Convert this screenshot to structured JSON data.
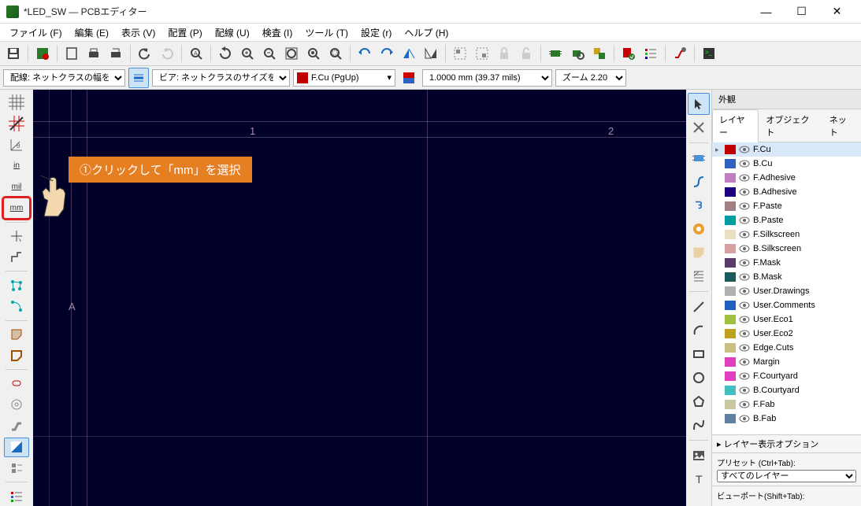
{
  "window": {
    "title": "*LED_SW — PCBエディター"
  },
  "menu": {
    "file": "ファイル (F)",
    "edit": "編集 (E)",
    "view": "表示 (V)",
    "place": "配置 (P)",
    "route": "配線 (U)",
    "inspect": "検査 (I)",
    "tools": "ツール (T)",
    "preferences": "設定 (r)",
    "help": "ヘルプ (H)"
  },
  "options_bar": {
    "track_width_label": "配線: ネットクラスの幅を使用",
    "via_label": "ビア: ネットクラスのサイズを使用",
    "active_layer": "F.Cu (PgUp)",
    "grid_value": "1.0000 mm (39.37 mils)",
    "zoom_value": "ズーム 2.20"
  },
  "left_toolbar": {
    "in_label": "in",
    "mil_label": "mil",
    "mm_label": "mm"
  },
  "canvas": {
    "col1": "1",
    "col2": "2",
    "rowA": "A"
  },
  "callout": {
    "text": "①クリックして「mm」を選択"
  },
  "appearance": {
    "title": "外観",
    "tabs": {
      "layers": "レイヤー",
      "objects": "オブジェクト",
      "nets": "ネット"
    },
    "layers": [
      {
        "name": "F.Cu",
        "color": "#c00000",
        "selected": true,
        "arrow": true
      },
      {
        "name": "B.Cu",
        "color": "#3060c0"
      },
      {
        "name": "F.Adhesive",
        "color": "#c080c0"
      },
      {
        "name": "B.Adhesive",
        "color": "#200080"
      },
      {
        "name": "F.Paste",
        "color": "#a08080"
      },
      {
        "name": "B.Paste",
        "color": "#00a0a0"
      },
      {
        "name": "F.Silkscreen",
        "color": "#e8e0c0"
      },
      {
        "name": "B.Silkscreen",
        "color": "#d8a0a0"
      },
      {
        "name": "F.Mask",
        "color": "#5a3a6a"
      },
      {
        "name": "B.Mask",
        "color": "#1a5a5a"
      },
      {
        "name": "User.Drawings",
        "color": "#b0b0b0"
      },
      {
        "name": "User.Comments",
        "color": "#2060c0"
      },
      {
        "name": "User.Eco1",
        "color": "#a0c040"
      },
      {
        "name": "User.Eco2",
        "color": "#c0a020"
      },
      {
        "name": "Edge.Cuts",
        "color": "#c8c080"
      },
      {
        "name": "Margin",
        "color": "#e040c0"
      },
      {
        "name": "F.Courtyard",
        "color": "#e040c0"
      },
      {
        "name": "B.Courtyard",
        "color": "#40c0c0"
      },
      {
        "name": "F.Fab",
        "color": "#c8c8a0"
      },
      {
        "name": "B.Fab",
        "color": "#6080a0"
      }
    ],
    "layer_options_label": "レイヤー表示オプション",
    "preset_label": "プリセット (Ctrl+Tab):",
    "preset_value": "すべてのレイヤー",
    "viewport_label": "ビューポート(Shift+Tab):"
  }
}
